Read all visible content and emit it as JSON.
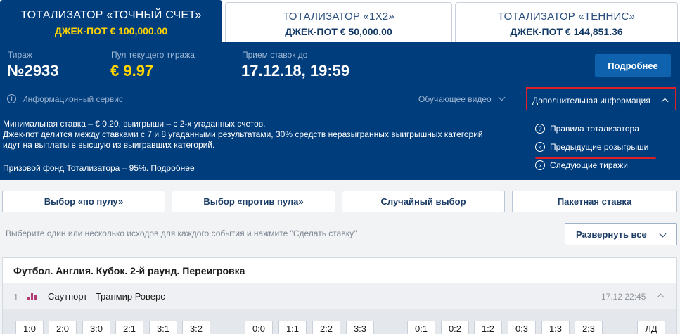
{
  "tabs": [
    {
      "title": "ТОТАЛИЗАТОР «ТОЧНЫЙ СЧЕТ»",
      "jackpot": "ДЖЕК-ПОТ € 100,000.00",
      "active": true
    },
    {
      "title": "ТОТАЛИЗАТОР «1Х2»",
      "jackpot": "ДЖЕК-ПОТ € 50,000.00",
      "active": false
    },
    {
      "title": "ТОТАЛИЗАТОР «ТЕННИС»",
      "jackpot": "ДЖЕК-ПОТ € 144,851.36",
      "active": false
    }
  ],
  "draw": {
    "draw_label": "Тираж",
    "draw_value": "№2933",
    "pool_label": "Пул текущего тиража",
    "pool_value": "€ 9.97",
    "deadline_label": "Прием ставок до",
    "deadline_value": "17.12.18, 19:59",
    "more_button": "Подробнее"
  },
  "info_bar": {
    "info_service": "Информационный сервис",
    "video": "Обучающее видео",
    "additional_info": "Дополнительная информация"
  },
  "panel": {
    "lines": [
      "Минимальная ставка – € 0.20, выигрыши – с 2-х угаданных счетов.",
      "Джек-пот делится между ставками с 7 и 8 угаданными результатами, 30% средств неразыгранных выигрышных категорий",
      "идут на выплаты в высшую из выигравших категорий."
    ],
    "fund_text": "Призовой фонд Тотализатора – 95%.",
    "fund_link": "Подробнее",
    "side_links": [
      {
        "label": "Правила тотализатора",
        "icon": "?"
      },
      {
        "label": "Предыдущие розыгрыши",
        "icon": "‹"
      },
      {
        "label": "Следующие тиражи",
        "icon": "›"
      }
    ]
  },
  "choices": [
    "Выбор «по пулу»",
    "Выбор «против пула»",
    "Случайный выбор",
    "Пакетная ставка"
  ],
  "hint": "Выберите один или несколько исходов для каждого события и нажмите \"Сделать ставку\"",
  "expand_all": "Развернуть все",
  "event": {
    "title": "Футбол. Англия. Кубок. 2-й раунд. Переигровка",
    "number": "1",
    "home": "Саутпорт",
    "separator": " - ",
    "away": "Транмир Роверс",
    "time": "17.12 22:45",
    "scores": [
      "1:0",
      "2:0",
      "3:0",
      "2:1",
      "3:1",
      "3:2",
      "0:0",
      "1:1",
      "2:2",
      "3:3",
      "0:1",
      "0:2",
      "1:2",
      "0:3",
      "1:3",
      "2:3",
      "ЛД"
    ]
  },
  "colors": {
    "header_blue": "#003d7d",
    "jackpot_yellow": "#ffd400",
    "highlight_red": "#e01f26",
    "button_blue": "#0f62ad"
  }
}
